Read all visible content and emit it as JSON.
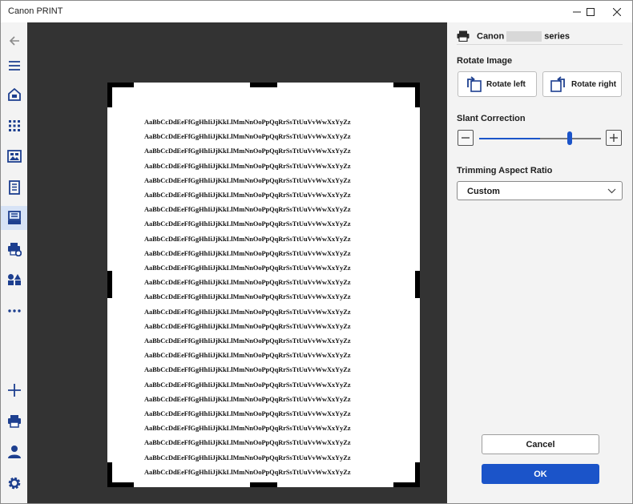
{
  "window": {
    "title": "Canon PRINT",
    "controls": [
      "minimize-icon",
      "maximize-icon",
      "close-icon"
    ]
  },
  "sidebar": {
    "items": [
      {
        "icon": "back-arrow-icon",
        "active": false
      },
      {
        "icon": "menu-icon",
        "active": false
      },
      {
        "icon": "home-icon",
        "active": false
      },
      {
        "icon": "apps-grid-icon",
        "active": false
      },
      {
        "icon": "photo-print-icon",
        "active": false
      },
      {
        "icon": "document-print-icon",
        "active": false
      },
      {
        "icon": "scan-icon",
        "active": true
      },
      {
        "icon": "printer-settings-icon",
        "active": false
      },
      {
        "icon": "shapes-icon",
        "active": false
      },
      {
        "icon": "more-icon",
        "active": false
      },
      {
        "icon": "add-icon",
        "active": false
      },
      {
        "icon": "printer-icon",
        "active": false
      },
      {
        "icon": "account-icon",
        "active": false
      },
      {
        "icon": "settings-gear-icon",
        "active": false
      }
    ]
  },
  "preview": {
    "lines": [
      "AaBbCcDdEeFfGgHhIiJjKkLlMmNnOoPpQqRrSsTtUuVvWwXxYyZz",
      "AaBbCcDdEeFfGgHhIiJjKkLlMmNnOoPpQqRrSsTtUuVvWwXxYyZz",
      "AaBbCcDdEeFfGgHhIiJjKkLlMmNnOoPpQqRrSsTtUuVvWwXxYyZz",
      "AaBbCcDdEeFfGgHhIiJjKkLlMmNnOoPpQqRrSsTtUuVvWwXxYyZz",
      "AaBbCcDdEeFfGgHhIiJjKkLlMmNnOoPpQqRrSsTtUuVvWwXxYyZz",
      "AaBbCcDdEeFfGgHhIiJjKkLlMmNnOoPpQqRrSsTtUuVvWwXxYyZz",
      "AaBbCcDdEeFfGgHhIiJjKkLlMmNnOoPpQqRrSsTtUuVvWwXxYyZz",
      "AaBbCcDdEeFfGgHhIiJjKkLlMmNnOoPpQqRrSsTtUuVvWwXxYyZz",
      "AaBbCcDdEeFfGgHhIiJjKkLlMmNnOoPpQqRrSsTtUuVvWwXxYyZz",
      "AaBbCcDdEeFfGgHhIiJjKkLlMmNnOoPpQqRrSsTtUuVvWwXxYyZz",
      "AaBbCcDdEeFfGgHhIiJjKkLlMmNnOoPpQqRrSsTtUuVvWwXxYyZz",
      "AaBbCcDdEeFfGgHhIiJjKkLlMmNnOoPpQqRrSsTtUuVvWwXxYyZz",
      "AaBbCcDdEeFfGgHhIiJjKkLlMmNnOoPpQqRrSsTtUuVvWwXxYyZz",
      "AaBbCcDdEeFfGgHhIiJjKkLlMmNnOoPpQqRrSsTtUuVvWwXxYyZz",
      "AaBbCcDdEeFfGgHhIiJjKkLlMmNnOoPpQqRrSsTtUuVvWwXxYyZz",
      "AaBbCcDdEeFfGgHhIiJjKkLlMmNnOoPpQqRrSsTtUuVvWwXxYyZz",
      "AaBbCcDdEeFfGgHhIiJjKkLlMmNnOoPpQqRrSsTtUuVvWwXxYyZz",
      "AaBbCcDdEeFfGgHhIiJjKkLlMmNnOoPpQqRrSsTtUuVvWwXxYyZz",
      "AaBbCcDdEeFfGgHhIiJjKkLlMmNnOoPpQqRrSsTtUuVvWwXxYyZz",
      "AaBbCcDdEeFfGgHhIiJjKkLlMmNnOoPpQqRrSsTtUuVvWwXxYyZz",
      "AaBbCcDdEeFfGgHhIiJjKkLlMmNnOoPpQqRrSsTtUuVvWwXxYyZz",
      "AaBbCcDdEeFfGgHhIiJjKkLlMmNnOoPpQqRrSsTtUuVvWwXxYyZz",
      "AaBbCcDdEeFfGgHhIiJjKkLlMmNnOoPpQqRrSsTtUuVvWwXxYyZz",
      "AaBbCcDdEeFfGgHhIiJjKkLlMmNnOoPpQqRrSsTtUuVvWwXxYyZz",
      "AaBbCcDdEeFfGgHhIiJjKkLlMmNnOoPpQqRrSsTtUuVvWwXxYyZz"
    ]
  },
  "panel": {
    "printer": {
      "prefix": "Canon",
      "suffix": "series",
      "icon": "printer-icon"
    },
    "rotate": {
      "heading": "Rotate Image",
      "left_label": "Rotate left",
      "right_label": "Rotate right"
    },
    "slant": {
      "heading": "Slant Correction",
      "value": 0.5
    },
    "trimming": {
      "heading": "Trimming Aspect Ratio",
      "selected": "Custom"
    },
    "cancel_label": "Cancel",
    "ok_label": "OK"
  },
  "colors": {
    "accent": "#1b54c9",
    "preview_background": "#333333",
    "panel_background": "#f3f3f3",
    "active_nav": "#d7e3f6"
  }
}
